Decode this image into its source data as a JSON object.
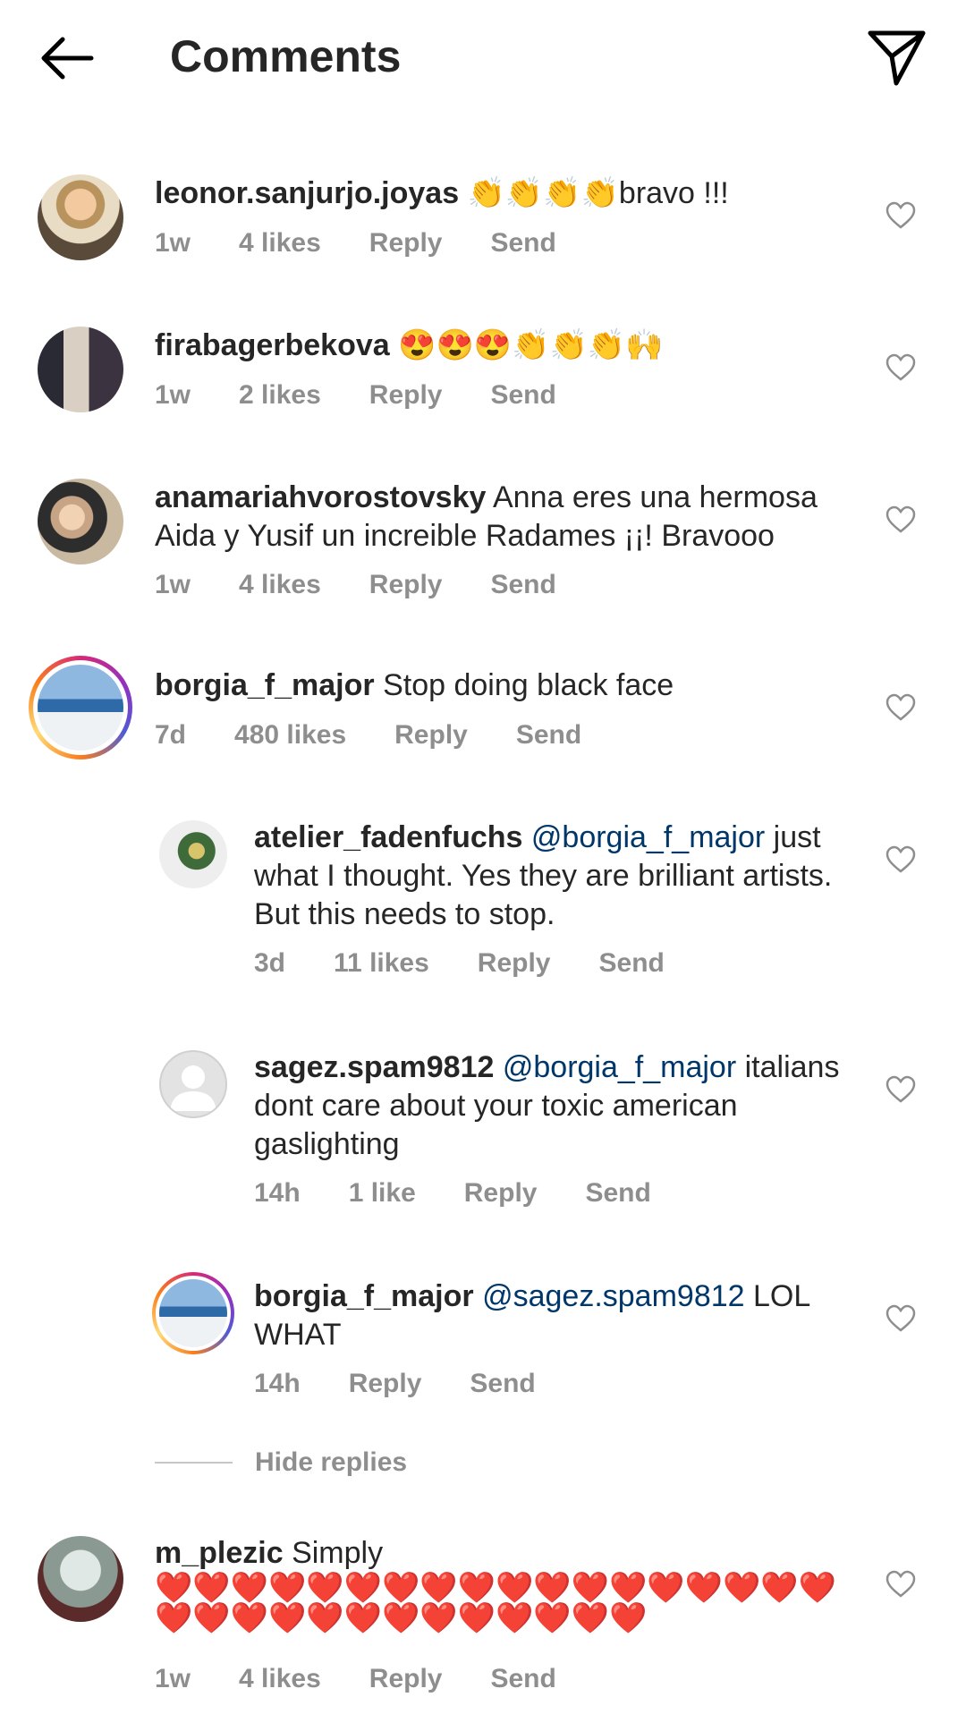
{
  "header": {
    "title": "Comments"
  },
  "comments": [
    {
      "username": "leonor.sanjurjo.joyas",
      "emoji": "👏👏👏👏",
      "text": "bravo !!!",
      "time": "1w",
      "likes": "4 likes",
      "reply": "Reply",
      "send": "Send"
    },
    {
      "username": "firabagerbekova",
      "emoji": "😍😍😍👏👏👏🙌",
      "text": "",
      "time": "1w",
      "likes": "2 likes",
      "reply": "Reply",
      "send": "Send"
    },
    {
      "username": "anamariahvorostovsky",
      "text": "Anna eres una hermosa Aida y Yusif un increible Radames ¡¡! Bravooo",
      "time": "1w",
      "likes": "4 likes",
      "reply": "Reply",
      "send": "Send"
    },
    {
      "username": "borgia_f_major",
      "text": "Stop doing black face",
      "time": "7d",
      "likes": "480 likes",
      "reply": "Reply",
      "send": "Send"
    }
  ],
  "replies": [
    {
      "username": "atelier_fadenfuchs",
      "mention": "@borgia_f_major",
      "text": "just what I thought. Yes they are brilliant artists. But this needs to stop.",
      "time": "3d",
      "likes": "11 likes",
      "reply": "Reply",
      "send": "Send"
    },
    {
      "username": "sagez.spam9812",
      "mention": "@borgia_f_major",
      "text": "italians dont care about your toxic american gaslighting",
      "time": "14h",
      "likes": "1 like",
      "reply": "Reply",
      "send": "Send"
    },
    {
      "username": "borgia_f_major",
      "mention": "@sagez.spam9812",
      "text": "LOL WHAT",
      "time": "14h",
      "reply": "Reply",
      "send": "Send"
    }
  ],
  "hide_replies": "Hide replies",
  "last_comment": {
    "username": "m_plezic",
    "text": "Simply",
    "emoji": "❤️❤️❤️❤️❤️❤️❤️❤️❤️❤️❤️❤️❤️❤️❤️❤️❤️❤️❤️❤️❤️❤️❤️❤️❤️❤️❤️❤️❤️❤️❤️",
    "time": "1w",
    "likes": "4 likes",
    "reply": "Reply",
    "send": "Send"
  },
  "colors": {
    "text": "#262626",
    "meta": "#8e8e8e",
    "mention": "#00376b"
  },
  "icons": {
    "back": "arrow-left-icon",
    "share": "paper-plane-icon",
    "like": "heart-outline-icon"
  }
}
